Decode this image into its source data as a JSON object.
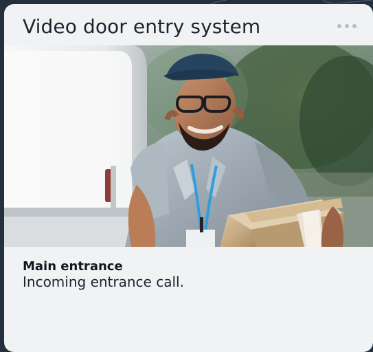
{
  "card": {
    "title": "Video door entry system",
    "more_label": "More options",
    "location": "Main entrance",
    "message": "Incoming entrance call."
  },
  "icons": {
    "more": "more-horizontal-icon",
    "camera_feed": "doorbell-camera-feed"
  },
  "colors": {
    "page_background": "#24303d",
    "card_background": "#f1f2f4",
    "title_text": "#1d2430",
    "body_text": "#1a2230",
    "muted_icon": "#b8bec7"
  }
}
